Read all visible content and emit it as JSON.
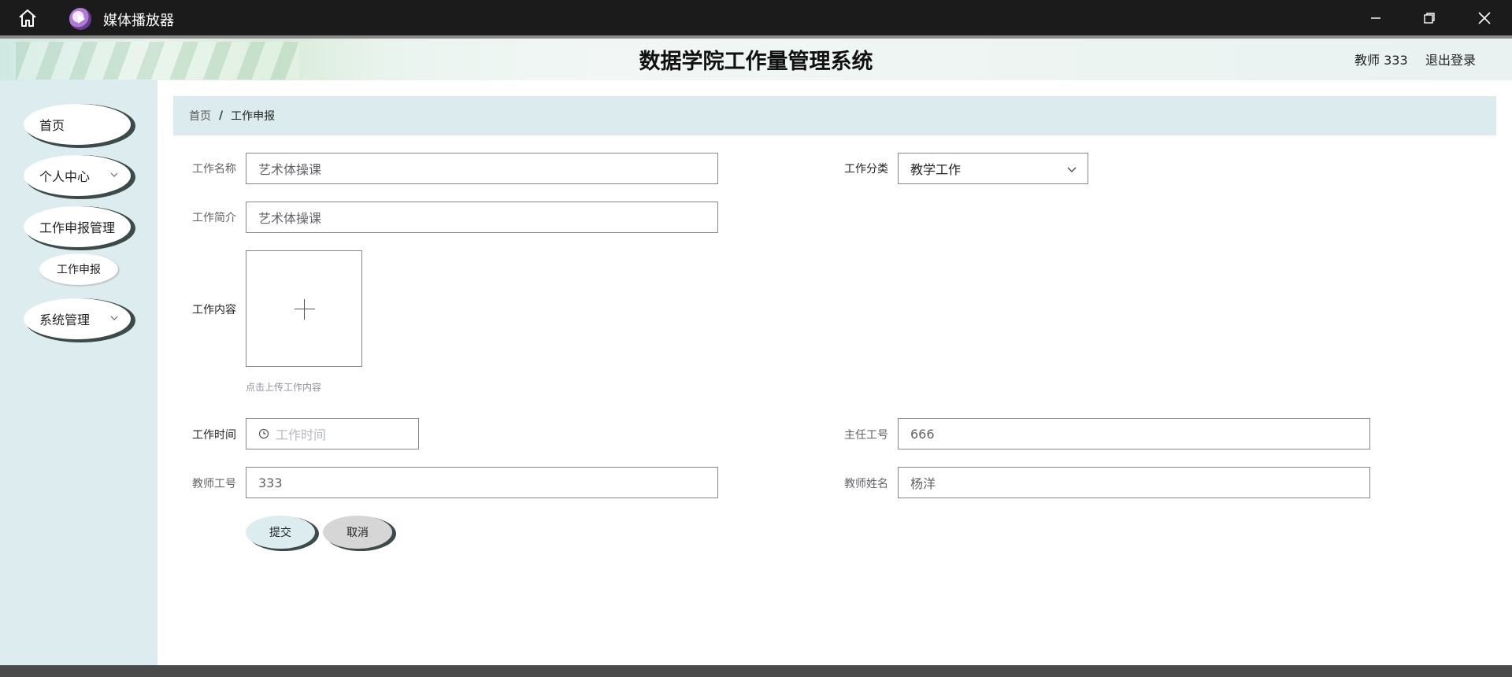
{
  "window": {
    "app_title": "媒体播放器",
    "home_icon": "home-icon",
    "controls": [
      "minimize-icon",
      "restore-icon",
      "close-icon"
    ]
  },
  "header": {
    "system_title": "数据学院工作量管理系统",
    "user": "教师 333",
    "logout": "退出登录"
  },
  "sidebar": {
    "items": [
      {
        "label": "首页",
        "has_submenu": false
      },
      {
        "label": "个人中心",
        "has_submenu": true
      },
      {
        "label": "工作申报管理",
        "has_submenu": false
      },
      {
        "label": "工作申报",
        "sub": true
      },
      {
        "label": "系统管理",
        "has_submenu": true
      }
    ]
  },
  "breadcrumb": {
    "home": "首页",
    "separator": "/",
    "current": "工作申报"
  },
  "form": {
    "work_name": {
      "label": "工作名称",
      "value": "艺术体操课"
    },
    "work_category": {
      "label": "工作分类",
      "value": "教学工作"
    },
    "work_intro": {
      "label": "工作简介",
      "value": "艺术体操课"
    },
    "work_content": {
      "label": "工作内容",
      "tip": "点击上传工作内容"
    },
    "work_time": {
      "label": "工作时间",
      "placeholder": "工作时间"
    },
    "director_id": {
      "label": "主任工号",
      "value": "666"
    },
    "teacher_id": {
      "label": "教师工号",
      "value": "333"
    },
    "teacher_name": {
      "label": "教师姓名",
      "value": "杨洋"
    },
    "submit": "提交",
    "cancel": "取消"
  },
  "colors": {
    "titlebar": "#1b1b1b",
    "sidebar": "#ddecef",
    "breadcrumb_bg": "#dcebed",
    "pill_shadow": "#3c4a4a"
  }
}
